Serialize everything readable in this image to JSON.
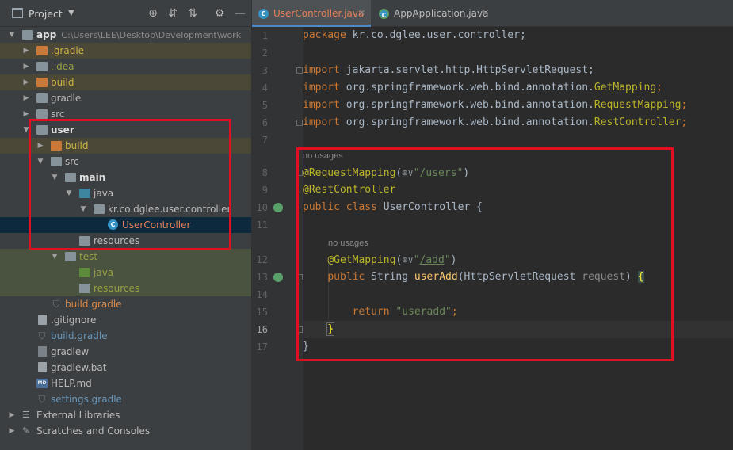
{
  "project_panel": {
    "title": "Project",
    "toolbar_icons": [
      "crosshair-icon",
      "expand-all-icon",
      "collapse-all-icon",
      "gear-icon",
      "minimize-icon"
    ],
    "tree": [
      {
        "label": "app",
        "path": "C:\\Users\\LEE\\Desktop\\Development\\work",
        "icon": "module-folder-icon",
        "expanded": true
      },
      {
        "label": ".gradle",
        "icon": "folder-orange-icon",
        "expanded": false
      },
      {
        "label": ".idea",
        "icon": "folder-icon",
        "expanded": false
      },
      {
        "label": "build",
        "icon": "folder-orange-icon",
        "expanded": false
      },
      {
        "label": "gradle",
        "icon": "folder-icon",
        "expanded": false
      },
      {
        "label": "src",
        "icon": "folder-icon",
        "expanded": false
      },
      {
        "label": "user",
        "icon": "module-folder-icon",
        "expanded": true
      },
      {
        "label": "build",
        "icon": "folder-orange-icon",
        "expanded": false
      },
      {
        "label": "src",
        "icon": "folder-icon",
        "expanded": true
      },
      {
        "label": "main",
        "icon": "folder-icon",
        "expanded": true
      },
      {
        "label": "java",
        "icon": "folder-blue-icon",
        "expanded": true
      },
      {
        "label": "kr.co.dglee.user.controller",
        "icon": "package-icon",
        "expanded": true
      },
      {
        "label": "UserController",
        "icon": "class-icon"
      },
      {
        "label": "resources",
        "icon": "resources-folder-icon"
      },
      {
        "label": "test",
        "icon": "folder-icon",
        "expanded": true
      },
      {
        "label": "java",
        "icon": "folder-green-icon"
      },
      {
        "label": "resources",
        "icon": "resources-folder-icon"
      },
      {
        "label": "build.gradle",
        "icon": "gradle-icon"
      },
      {
        "label": ".gitignore",
        "icon": "file-icon"
      },
      {
        "label": "build.gradle",
        "icon": "gradle-icon"
      },
      {
        "label": "gradlew",
        "icon": "terminal-file-icon"
      },
      {
        "label": "gradlew.bat",
        "icon": "file-icon"
      },
      {
        "label": "HELP.md",
        "icon": "markdown-icon"
      },
      {
        "label": "settings.gradle",
        "icon": "gradle-icon"
      },
      {
        "label": "External Libraries",
        "icon": "libraries-icon",
        "expanded": false
      },
      {
        "label": "Scratches and Consoles",
        "icon": "scratches-icon",
        "expanded": false
      }
    ]
  },
  "editor": {
    "tabs": [
      {
        "label": "UserController.java",
        "active": true
      },
      {
        "label": "AppApplication.java",
        "active": false
      }
    ],
    "line_numbers": [
      "1",
      "2",
      "3",
      "4",
      "5",
      "6",
      "7",
      "8",
      "9",
      "10",
      "11",
      "12",
      "13",
      "14",
      "15",
      "16",
      "17"
    ],
    "usages_hint": "no usages",
    "code": {
      "l1_kw": "package",
      "l1_rest": " kr.co.dglee.user.controller;",
      "l3_kw": "import",
      "l3_rest": " jakarta.servlet.http.HttpServletRequest;",
      "l4_kw": "import",
      "l4_rest": " org.springframework.web.bind.annotation.",
      "l4_an": "GetMapping",
      "l5_kw": "import",
      "l5_rest": " org.springframework.web.bind.annotation.",
      "l5_an": "RequestMapping",
      "l6_kw": "import",
      "l6_rest": " org.springframework.web.bind.annotation.",
      "l6_an": "RestController",
      "semi": ";",
      "l8_an": "@RequestMapping",
      "l8_open": "(",
      "l8_globe": "⊕∨",
      "l8_q1": "\"",
      "l8_url": "/users",
      "l8_q2": "\"",
      "l8_close": ")",
      "l9_an": "@RestController",
      "l10_kw": "public class",
      "l10_rest": " UserController {",
      "l12_an": "@GetMapping",
      "l12_open": "(",
      "l12_globe": "⊕∨",
      "l12_q1": "\"",
      "l12_url": "/add",
      "l12_q2": "\"",
      "l12_close": ")",
      "l13_kw": "public",
      "l13_type": " String ",
      "l13_fn": "userAdd",
      "l13_rest": "(HttpServletRequest ",
      "l13_param": "request",
      "l13_end": ") ",
      "l13_brace": "{",
      "l15_kw": "return",
      "l15_str": " \"useradd\"",
      "l15_semi": ";",
      "l16_brace": "}",
      "l17_brace": "}"
    }
  }
}
